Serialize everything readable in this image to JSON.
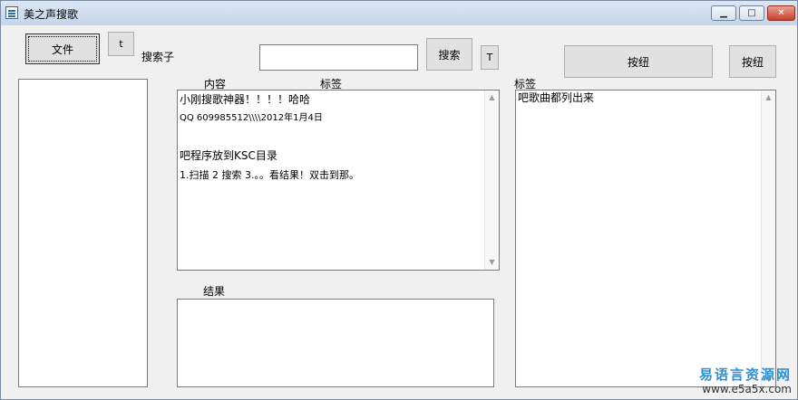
{
  "window": {
    "title": "美之声搜歌",
    "minimize_glyph": "▁",
    "maximize_glyph": "□",
    "close_glyph": "✕"
  },
  "toolbar": {
    "file_label": "文件",
    "t_small_label": "t",
    "search_label_text": "搜索子",
    "search_input_value": "",
    "search_button_label": "搜索",
    "t_big_label": "T",
    "wide_button_label": "按纽",
    "right_button_label": "按纽"
  },
  "content_panel": {
    "header_content": "内容",
    "header_tag": "标签",
    "lines": [
      "小刚搜歌神器！！！！哈哈",
      "QQ 609985512\\\\\\\\2012年1月4日",
      "",
      "吧程序放到KSC目录",
      "1.扫描   2 搜索  3.。。看结果！双击到那。"
    ]
  },
  "result_panel": {
    "label": "结果",
    "text": ""
  },
  "tag_panel": {
    "label": "标签",
    "text": "吧歌曲都列出来"
  },
  "left_list": {
    "items": []
  },
  "scrollbar": {
    "up_glyph": "▲",
    "down_glyph": "▼"
  },
  "watermark": {
    "line1": "易语言资源网",
    "line2": "www.e5a5x.com"
  }
}
